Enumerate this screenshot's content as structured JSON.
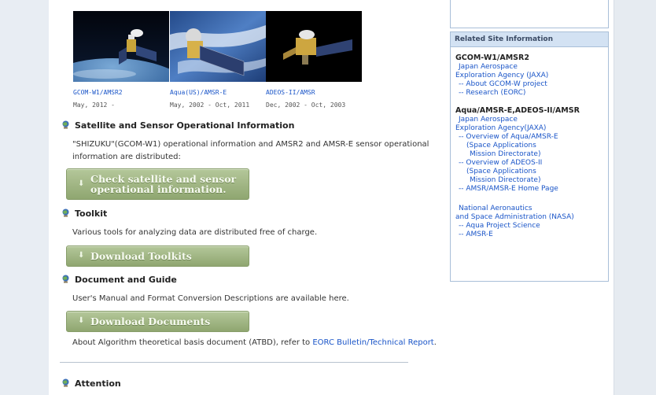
{
  "satellites": [
    {
      "name": "GCOM-W1/AMSR2",
      "dates": "May, 2012 -"
    },
    {
      "name": "Aqua(US)/AMSR-E",
      "dates": "May, 2002 - Oct, 2011"
    },
    {
      "name": "ADEOS-II/AMSR",
      "dates": "Dec, 2002 - Oct, 2003"
    }
  ],
  "sections": {
    "satellite": {
      "title": "Satellite and Sensor Operational Information",
      "desc_line1": "\"SHIZUKU\"(GCOM-W1) operational information and AMSR2 and AMSR-E sensor operational",
      "desc_line2": "information are distributed:",
      "button": "Check satellite and sensor\noperational information."
    },
    "toolkit": {
      "title": "Toolkit",
      "desc": "Various tools for analyzing data are distributed free of charge.",
      "button": "Download Toolkits"
    },
    "document": {
      "title": "Document and Guide",
      "desc": "User's Manual and Format Conversion Descriptions are available here.",
      "button": "Download Documents",
      "atbd_prefix": "About Algorithm theoretical basis document (ATBD), refer to ",
      "atbd_link": "EORC Bulletin/Technical Report",
      "atbd_suffix": "."
    },
    "attention": {
      "title": "Attention"
    }
  },
  "related": {
    "header": "Related Site Information",
    "lines": [
      {
        "text": "GCOM-W1/AMSR2",
        "style": "head"
      },
      {
        "text": "Japan Aerospace",
        "style": "blue"
      },
      {
        "text": "Exploration Agency (JAXA)",
        "style": "blue"
      },
      {
        "text": "-- About GCOM-W project",
        "style": "blue"
      },
      {
        "text": "-- Research (EORC)",
        "style": "blue"
      },
      {
        "text": "Aqua/AMSR-E,ADEOS-II/AMSR",
        "style": "head"
      },
      {
        "text": "Japan Aerospace",
        "style": "blue"
      },
      {
        "text": "Exploration Agency(JAXA)",
        "style": "blue"
      },
      {
        "text": "-- Overview of Aqua/AMSR-E",
        "style": "blue"
      },
      {
        "text": "(Space Applications",
        "style": "blue"
      },
      {
        "text": "Mission Directorate)",
        "style": "blue"
      },
      {
        "text": "-- Overview of ADEOS-II",
        "style": "blue"
      },
      {
        "text": "(Space Applications",
        "style": "blue"
      },
      {
        "text": "Mission Directorate)",
        "style": "blue"
      },
      {
        "text": "-- AMSR/AMSR-E Home Page",
        "style": "blue"
      },
      {
        "text": "National Aeronautics",
        "style": "blue"
      },
      {
        "text": "and Space Administration (NASA)",
        "style": "blue"
      },
      {
        "text": "-- Aqua Project Science",
        "style": "blue"
      },
      {
        "text": "-- AMSR-E",
        "style": "blue"
      }
    ]
  }
}
